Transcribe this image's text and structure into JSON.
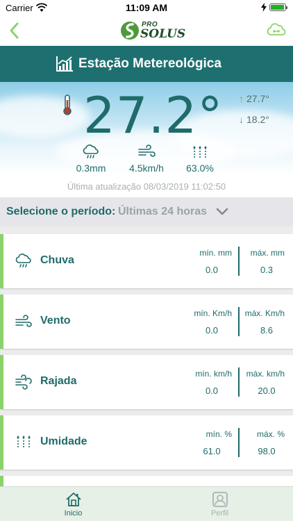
{
  "status_bar": {
    "carrier": "Carrier",
    "time": "11:09 AM",
    "battery_level": 1.0
  },
  "header": {
    "logo_pro": "PRO",
    "logo_solus": "SOLUS",
    "back_icon": "chevron-left-icon",
    "menu_icon": "cloud-icon"
  },
  "title": {
    "text": "Estação Metereológica",
    "icon": "chart-icon"
  },
  "weather": {
    "temperature": "27.2°",
    "max": "27.7°",
    "min": "18.2°",
    "rain": "0.3mm",
    "wind": "4.5km/h",
    "humidity": "63.0%",
    "last_update": "Última atualização 08/03/2019 11:02:50"
  },
  "period": {
    "label": "Selecione o período:",
    "value": "Últimas 24 horas"
  },
  "cards": [
    {
      "label": "Chuva",
      "icon": "rain-cloud-icon",
      "min_label": "mín. mm",
      "min_value": "0.0",
      "max_label": "máx. mm",
      "max_value": "0.3"
    },
    {
      "label": "Vento",
      "icon": "wind-icon",
      "min_label": "mín. Km/h",
      "min_value": "0.0",
      "max_label": "máx. Km/h",
      "max_value": "8.6"
    },
    {
      "label": "Rajada",
      "icon": "gust-icon",
      "min_label": "mín. km/h",
      "min_value": "0.0",
      "max_label": "máx. km/h",
      "max_value": "20.0"
    },
    {
      "label": "Umidade",
      "icon": "humidity-icon",
      "min_label": "mín. %",
      "min_value": "61.0",
      "max_label": "máx. %",
      "max_value": "98.0"
    }
  ],
  "tabs": [
    {
      "label": "Inicio",
      "icon": "home-icon",
      "active": true
    },
    {
      "label": "Perfil",
      "icon": "profile-icon",
      "active": false
    }
  ],
  "colors": {
    "primary": "#1e7070",
    "accent": "#8cd26a",
    "text": "#1e6b6a"
  }
}
